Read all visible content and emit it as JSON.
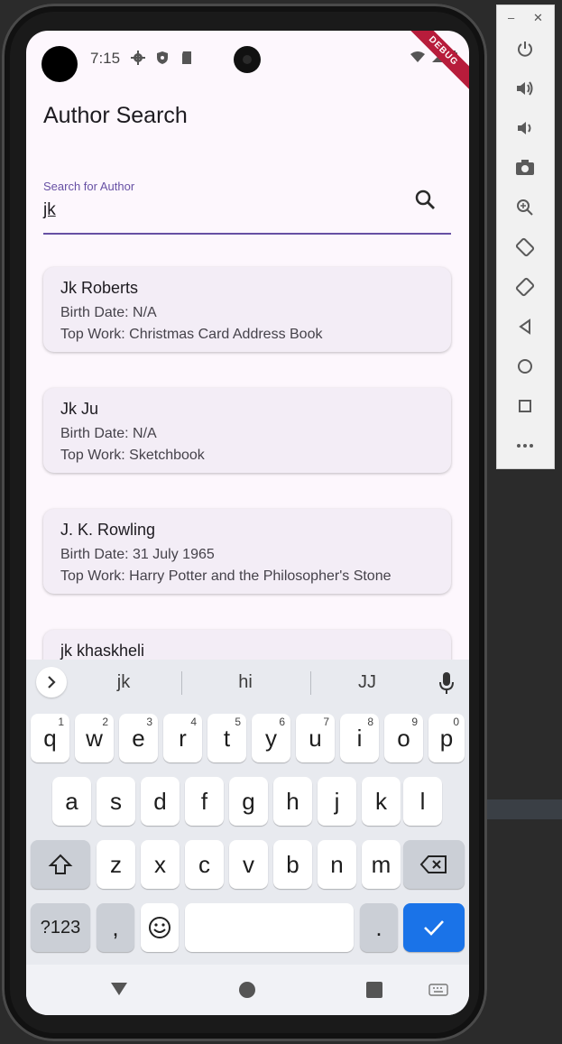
{
  "status_bar": {
    "time": "7:15",
    "debug_banner": "DEBUG"
  },
  "app": {
    "title": "Author Search",
    "search": {
      "label": "Search for Author",
      "value": "jk"
    },
    "results": [
      {
        "name": "Jk Roberts",
        "birth_date": "Birth Date: N/A",
        "top_work": "Top Work: Christmas Card Address Book"
      },
      {
        "name": "Jk Ju",
        "birth_date": "Birth Date: N/A",
        "top_work": "Top Work: Sketchbook"
      },
      {
        "name": "J. K. Rowling",
        "birth_date": "Birth Date: 31 July 1965",
        "top_work": "Top Work: Harry Potter and the Philosopher's Stone"
      },
      {
        "name": "jk khaskheli",
        "birth_date": "",
        "top_work": ""
      }
    ]
  },
  "keyboard": {
    "suggestions": [
      "jk",
      "hi",
      "JJ"
    ],
    "row1": [
      {
        "key": "q",
        "hint": "1"
      },
      {
        "key": "w",
        "hint": "2"
      },
      {
        "key": "e",
        "hint": "3"
      },
      {
        "key": "r",
        "hint": "4"
      },
      {
        "key": "t",
        "hint": "5"
      },
      {
        "key": "y",
        "hint": "6"
      },
      {
        "key": "u",
        "hint": "7"
      },
      {
        "key": "i",
        "hint": "8"
      },
      {
        "key": "o",
        "hint": "9"
      },
      {
        "key": "p",
        "hint": "0"
      }
    ],
    "row2": [
      "a",
      "s",
      "d",
      "f",
      "g",
      "h",
      "j",
      "k",
      "l"
    ],
    "row3": [
      "z",
      "x",
      "c",
      "v",
      "b",
      "n",
      "m"
    ],
    "symbols_key": "?123",
    "comma_key": ",",
    "period_key": "."
  },
  "colors": {
    "accent": "#6750a4",
    "enter_key": "#1a73e8",
    "debug_banner": "#b71c3b"
  }
}
